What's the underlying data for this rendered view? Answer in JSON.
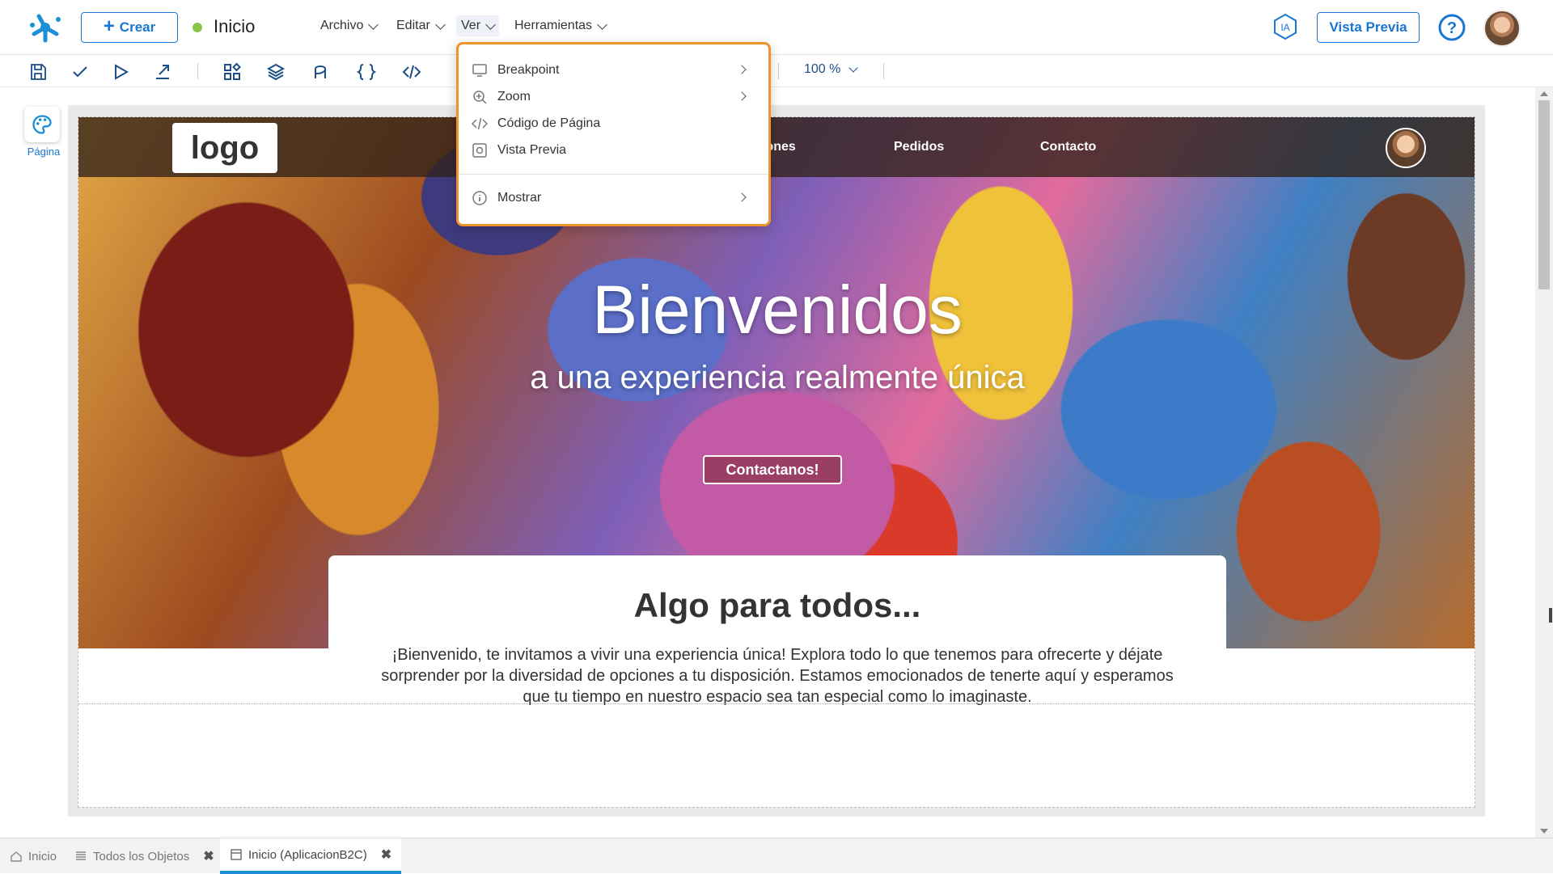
{
  "header": {
    "create_label": "Crear",
    "page_name": "Inicio",
    "status_color": "#8bc34a",
    "menus": [
      "Archivo",
      "Editar",
      "Ver",
      "Herramientas"
    ],
    "ia_label": "IA",
    "preview_label": "Vista Previa",
    "help_label": "?"
  },
  "toolbar": {
    "icons": [
      "save-icon",
      "check-icon",
      "play-icon",
      "export-icon",
      "components-icon",
      "layers-icon",
      "flow-icon",
      "braces-icon",
      "code-icon"
    ],
    "zoom": "100 %"
  },
  "rail": {
    "pagina_label": "Página"
  },
  "site": {
    "logo": "logo",
    "nav": [
      "iones",
      "Pedidos",
      "Contacto"
    ],
    "hero_title": "Bienvenidos",
    "hero_subtitle": "a una experiencia realmente única",
    "cta": "Contactanos!",
    "card_title": "Algo para todos...",
    "card_text": "¡Bienvenido, te invitamos a vivir una experiencia única! Explora todo lo que tenemos para ofrecerte y déjate sorprender por la diversidad de opciones a tu disposición. Estamos emocionados de tenerte aquí y esperamos que tu tiempo en nuestro espacio sea tan especial como lo imaginaste."
  },
  "ver_menu": {
    "items": [
      {
        "label": "Breakpoint",
        "icon": "monitor-icon",
        "submenu": true
      },
      {
        "label": "Zoom",
        "icon": "zoom-icon",
        "submenu": true
      },
      {
        "label": "Código de Página",
        "icon": "code-icon",
        "submenu": false
      },
      {
        "label": "Vista Previa",
        "icon": "preview-icon",
        "submenu": false
      },
      {
        "label": "Mostrar",
        "icon": "info-icon",
        "submenu": true
      }
    ]
  },
  "tabs": [
    {
      "label": "Inicio",
      "icon": "home-icon",
      "closable": false,
      "active": false
    },
    {
      "label": "Todos los Objetos",
      "icon": "list-icon",
      "closable": true,
      "active": false
    },
    {
      "label": "Inicio (AplicacionB2C)",
      "icon": "page-icon",
      "closable": true,
      "active": true
    }
  ],
  "colors": {
    "accent": "#1976d2",
    "dropdown_border": "#f0932f",
    "active_tab": "#1a8fd6"
  }
}
